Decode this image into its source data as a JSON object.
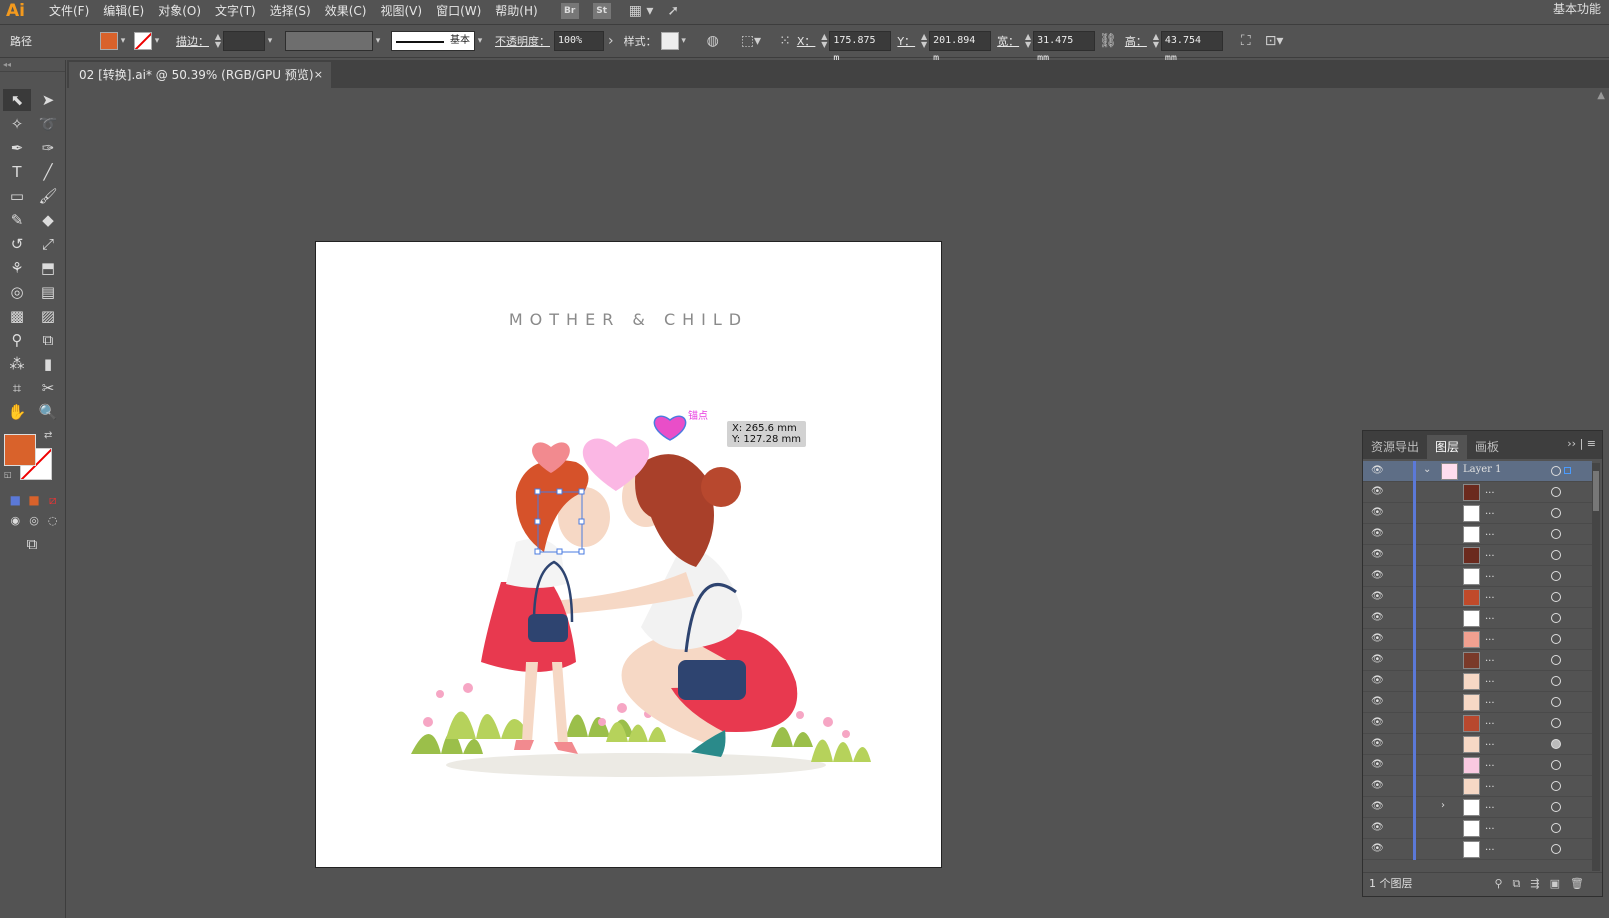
{
  "menubar": {
    "logo": "Ai",
    "items": [
      "文件(F)",
      "编辑(E)",
      "对象(O)",
      "文字(T)",
      "选择(S)",
      "效果(C)",
      "视图(V)",
      "窗口(W)",
      "帮助(H)"
    ],
    "bridge": "Br",
    "stock": "St",
    "workspace": "基本功能"
  },
  "control": {
    "object_type": "路径",
    "fill_color": "#d9622b",
    "stroke_label": "描边：",
    "stroke_style": "基本",
    "opacity_label": "不透明度：",
    "opacity": "100%",
    "style_label": "样式：",
    "x_label": "X：",
    "x": "175.875 m",
    "y_label": "Y：",
    "y": "201.894 m",
    "w_label": "宽：",
    "w": "31.475 mm",
    "h_label": "高：",
    "h": "43.754 mm"
  },
  "document": {
    "tab_title": "02 [转换].ai* @ 50.39% (RGB/GPU 预览)",
    "close": "×"
  },
  "artboard": {
    "title": "MOTHER & CHILD"
  },
  "overlay": {
    "anchor_label": "锚点",
    "coord_x": "X: 265.6 mm",
    "coord_y": "Y: 127.28 mm"
  },
  "layers_panel": {
    "tabs": [
      "资源导出",
      "图层",
      "画板"
    ],
    "active_tab": "图层",
    "top_layer": "Layer 1",
    "sublayer_placeholder": "...",
    "footer": "1 个图层"
  },
  "colors": {
    "accent": "#d9622b",
    "selection": "#5b79d8"
  }
}
